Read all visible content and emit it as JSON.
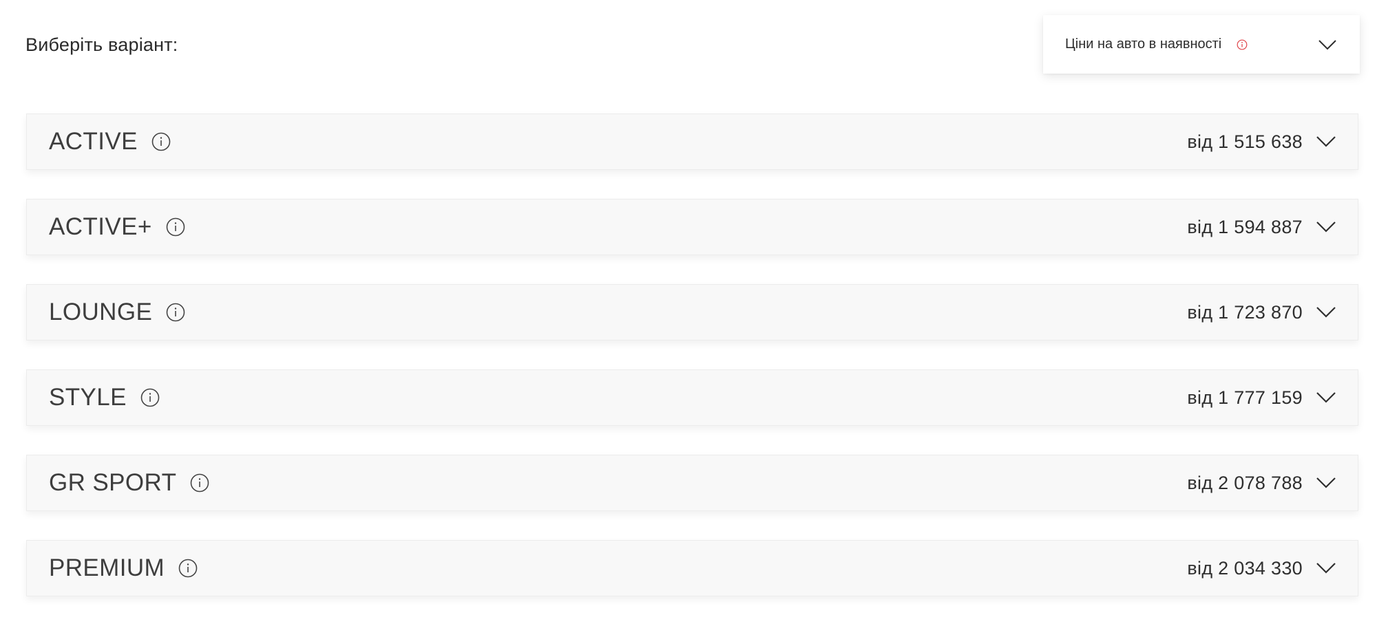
{
  "heading": "Виберіть варіант:",
  "stock_dropdown": {
    "label": "Ціни на авто в наявності",
    "info_icon": "info-icon",
    "chevron_icon": "chevron-down-icon",
    "accent_color": "#e0464b"
  },
  "variants": [
    {
      "name": "ACTIVE",
      "price": "від 1 515 638"
    },
    {
      "name": "ACTIVE+",
      "price": "від 1 594 887"
    },
    {
      "name": "LOUNGE",
      "price": "від 1 723 870"
    },
    {
      "name": "STYLE",
      "price": "від 1 777 159"
    },
    {
      "name": "GR SPORT",
      "price": "від 2 078 788"
    },
    {
      "name": "PREMIUM",
      "price": "від 2 034 330"
    }
  ]
}
